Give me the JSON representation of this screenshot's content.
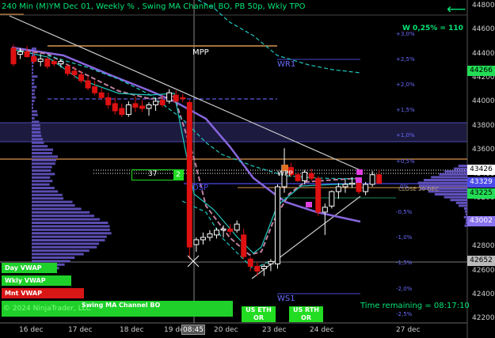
{
  "header": {
    "title": "240 Min (M)YM Dec 01, Weekly % , Swing MA Channel BO, PB 50p, Wkly TPO",
    "back_label": "⟵",
    "weekly_pct": "W 0,25% = 110"
  },
  "labels": {
    "mpp": "MPP",
    "wr1": "WR1",
    "ws1": "WS1",
    "wpp": "WPP",
    "dsp": "DSP",
    "close_label": "CLOSE 20 DEC"
  },
  "counter_box": {
    "count": "37",
    "badge": "2"
  },
  "buttons": {
    "day_vwap": "Day VWAP",
    "wkly_vwap": "Wkly VWAP",
    "mnt_vwap": "Mnt VWAP",
    "swing_ma": "Swing MA Channel BO",
    "us_eth_or": "US ETH OR",
    "us_rth_or": "US RTH OR"
  },
  "footer": {
    "copyright": "© 2024 NinjaTrader, LLC",
    "time_remaining": "Time remaining = 08:17:10"
  },
  "y_axis": {
    "ticks": [
      "44800",
      "44600",
      "44400",
      "44200",
      "44000",
      "43800",
      "43600",
      "43400",
      "43200",
      "43000",
      "42800",
      "42600",
      "42400",
      "42200"
    ],
    "price_tags": [
      {
        "value": "44266",
        "color": "#22dd55",
        "text_color": "#000000"
      },
      {
        "value": "43426",
        "color": "#ffffff",
        "text_color": "#000000"
      },
      {
        "value": "43329",
        "color": "#4a4ae8",
        "text_color": "#ffffff"
      },
      {
        "value": "43225",
        "color": "#22dd55",
        "text_color": "#000000"
      },
      {
        "value": "43002",
        "color": "#8a73ee",
        "text_color": "#ffffff"
      },
      {
        "value": "42652",
        "color": "#bbbbbb",
        "text_color": "#000000"
      }
    ]
  },
  "pct_levels": [
    "+3,0%",
    "+2,5%",
    "+2,0%",
    "+1,5%",
    "+1,0%",
    "+0,5%",
    "0%",
    "-0,5%",
    "-1,0%",
    "-1,5%",
    "-2,0%",
    "-2,5%"
  ],
  "x_axis": {
    "ticks": [
      "16 dec",
      "17 dec",
      "18 dec",
      "19 dec",
      "20 dec",
      "23 dec",
      "24 dec",
      "27 dec"
    ],
    "cursor_time": "08:45"
  },
  "colors": {
    "up": "#ffffff",
    "down": "#dd1111",
    "ma_fast": "#20c8c0",
    "ma_slow": "#8866dd",
    "tpo": "#6a5ad0",
    "highlight_green": "#00e676"
  },
  "chart_data": {
    "type": "candlestick",
    "y_unit": "price",
    "ylim": [
      42150,
      44850
    ],
    "candles": [
      {
        "o": 44450,
        "h": 44480,
        "l": 44300,
        "c": 44320
      },
      {
        "o": 44400,
        "h": 44450,
        "l": 44360,
        "c": 44420
      },
      {
        "o": 44420,
        "h": 44470,
        "l": 44370,
        "c": 44380
      },
      {
        "o": 44380,
        "h": 44420,
        "l": 44320,
        "c": 44340
      },
      {
        "o": 44340,
        "h": 44400,
        "l": 44300,
        "c": 44360
      },
      {
        "o": 44360,
        "h": 44380,
        "l": 44280,
        "c": 44300
      },
      {
        "o": 44340,
        "h": 44360,
        "l": 44300,
        "c": 44320
      },
      {
        "o": 44320,
        "h": 44360,
        "l": 44290,
        "c": 44340
      },
      {
        "o": 44300,
        "h": 44310,
        "l": 44220,
        "c": 44240
      },
      {
        "o": 44260,
        "h": 44300,
        "l": 44200,
        "c": 44230
      },
      {
        "o": 44230,
        "h": 44260,
        "l": 44160,
        "c": 44180
      },
      {
        "o": 44180,
        "h": 44220,
        "l": 44100,
        "c": 44120
      },
      {
        "o": 44130,
        "h": 44180,
        "l": 44060,
        "c": 44080
      },
      {
        "o": 44080,
        "h": 44120,
        "l": 44020,
        "c": 44040
      },
      {
        "o": 44040,
        "h": 44080,
        "l": 43950,
        "c": 43980
      },
      {
        "o": 43990,
        "h": 44040,
        "l": 43900,
        "c": 43930
      },
      {
        "o": 43950,
        "h": 43990,
        "l": 43880,
        "c": 43900
      },
      {
        "o": 43900,
        "h": 44010,
        "l": 43880,
        "c": 43980
      },
      {
        "o": 43990,
        "h": 44050,
        "l": 43920,
        "c": 43960
      },
      {
        "o": 43970,
        "h": 44020,
        "l": 43920,
        "c": 43950
      },
      {
        "o": 43950,
        "h": 44000,
        "l": 43890,
        "c": 43980
      },
      {
        "o": 43980,
        "h": 44040,
        "l": 43930,
        "c": 44010
      },
      {
        "o": 44020,
        "h": 44060,
        "l": 43960,
        "c": 43980
      },
      {
        "o": 44010,
        "h": 44110,
        "l": 43990,
        "c": 44080
      },
      {
        "o": 44060,
        "h": 44100,
        "l": 44000,
        "c": 44010
      },
      {
        "o": 44040,
        "h": 44070,
        "l": 44000,
        "c": 44030
      },
      {
        "o": 44000,
        "h": 44020,
        "l": 42700,
        "c": 42800
      },
      {
        "o": 42820,
        "h": 42880,
        "l": 42760,
        "c": 42860
      },
      {
        "o": 42860,
        "h": 42920,
        "l": 42820,
        "c": 42880
      },
      {
        "o": 42880,
        "h": 42940,
        "l": 42850,
        "c": 42910
      },
      {
        "o": 42900,
        "h": 42960,
        "l": 42870,
        "c": 42940
      },
      {
        "o": 42940,
        "h": 42980,
        "l": 42880,
        "c": 42950
      },
      {
        "o": 42950,
        "h": 42990,
        "l": 42900,
        "c": 42930
      },
      {
        "o": 42940,
        "h": 43020,
        "l": 42920,
        "c": 42990
      },
      {
        "o": 42900,
        "h": 42950,
        "l": 42700,
        "c": 42720
      },
      {
        "o": 42700,
        "h": 42720,
        "l": 42600,
        "c": 42640
      },
      {
        "o": 42640,
        "h": 42680,
        "l": 42560,
        "c": 42600
      },
      {
        "o": 42620,
        "h": 42660,
        "l": 42560,
        "c": 42640
      },
      {
        "o": 42660,
        "h": 42700,
        "l": 42600,
        "c": 42680
      },
      {
        "o": 42660,
        "h": 43320,
        "l": 42620,
        "c": 43300
      },
      {
        "o": 43300,
        "h": 43620,
        "l": 43250,
        "c": 43480
      },
      {
        "o": 43460,
        "h": 43500,
        "l": 43380,
        "c": 43400
      },
      {
        "o": 43400,
        "h": 43420,
        "l": 43340,
        "c": 43350
      },
      {
        "o": 43350,
        "h": 43440,
        "l": 43320,
        "c": 43420
      },
      {
        "o": 43410,
        "h": 43450,
        "l": 43350,
        "c": 43370
      },
      {
        "o": 43370,
        "h": 43390,
        "l": 43060,
        "c": 43090
      },
      {
        "o": 43090,
        "h": 43160,
        "l": 42900,
        "c": 43130
      },
      {
        "o": 43140,
        "h": 43270,
        "l": 43120,
        "c": 43260
      },
      {
        "o": 43260,
        "h": 43330,
        "l": 43200,
        "c": 43300
      },
      {
        "o": 43300,
        "h": 43360,
        "l": 43250,
        "c": 43320
      },
      {
        "o": 43320,
        "h": 43380,
        "l": 43290,
        "c": 43330
      },
      {
        "o": 43330,
        "h": 43360,
        "l": 43240,
        "c": 43260
      },
      {
        "o": 43260,
        "h": 43340,
        "l": 43230,
        "c": 43320
      },
      {
        "o": 43320,
        "h": 43430,
        "l": 43300,
        "c": 43400
      },
      {
        "o": 43400,
        "h": 43440,
        "l": 43320,
        "c": 43330
      }
    ]
  }
}
